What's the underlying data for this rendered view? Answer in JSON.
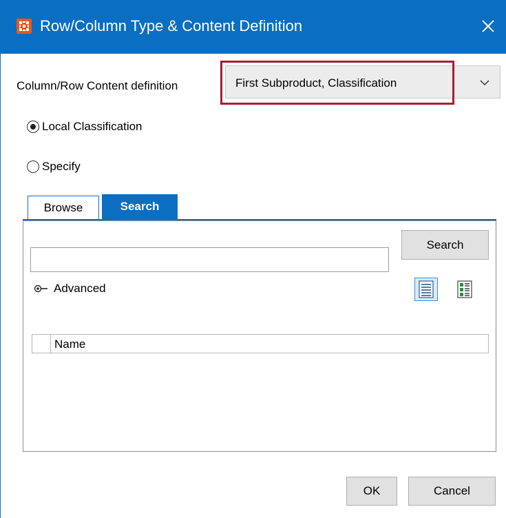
{
  "window": {
    "title": "Row/Column Type & Content Definition",
    "close_icon": "close-icon",
    "app_icon": "app-grid-icon",
    "accent_color": "#0a6ec2",
    "highlight_color": "#a31f2f"
  },
  "content_definition": {
    "label": "Column/Row Content definition",
    "selected_value": "First Subproduct, Classification"
  },
  "options": {
    "local_classification": {
      "label": "Local Classification",
      "checked": true
    },
    "specify": {
      "label": "Specify",
      "checked": false
    }
  },
  "tabs": [
    {
      "label": "Browse",
      "active": false
    },
    {
      "label": "Search",
      "active": true
    }
  ],
  "search": {
    "input_value": "",
    "button_label": "Search",
    "advanced_label": "Advanced",
    "view_icons": [
      "list-view-icon",
      "detail-view-icon"
    ]
  },
  "results": {
    "columns": [
      "Name"
    ]
  },
  "footer": {
    "ok_label": "OK",
    "cancel_label": "Cancel"
  }
}
